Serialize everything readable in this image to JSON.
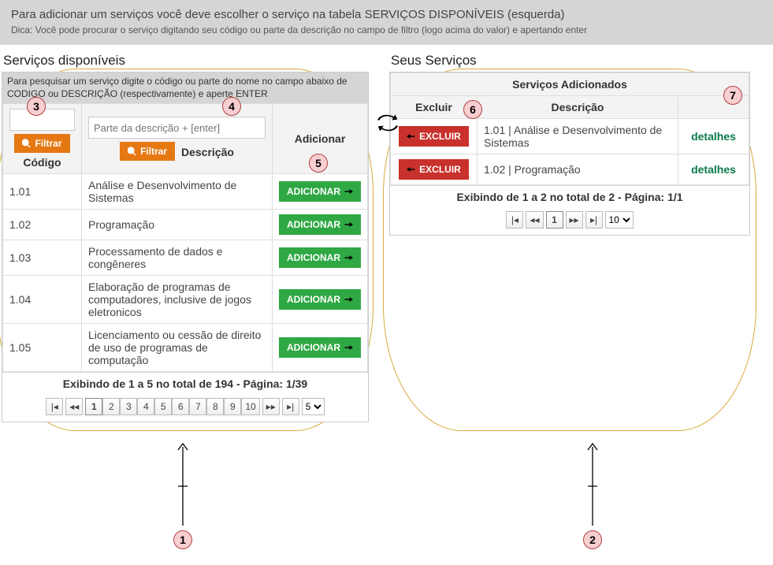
{
  "banner": {
    "title": "Para adicionar um serviços você deve escolher o serviço na tabela SERVIÇOS DISPONÍVEIS (esquerda)",
    "hint": "Dica: Você pode procurar o serviço digitando seu código ou parte da descrição no campo de filtro (logo acima do valor) e apertando enter"
  },
  "left": {
    "title": "Serviços disponíveis",
    "searchHint": "Para pesquisar um serviço digite o código ou parte do nome no campo abaixo de CODIGO ou DESCRIÇÃO (respectivamente) e aperte ENTER",
    "headers": {
      "codigo": "Código",
      "descricao": "Descrição",
      "adicionar": "Adicionar"
    },
    "filters": {
      "codigo_placeholder": "",
      "descricao_placeholder": "Parte da descrição + [enter]",
      "botao_label": "Filtrar"
    },
    "btn_add_label": "ADICIONAR",
    "rows": [
      {
        "codigo": "1.01",
        "descricao": "Análise e Desenvolvimento de Sistemas"
      },
      {
        "codigo": "1.02",
        "descricao": "Programação"
      },
      {
        "codigo": "1.03",
        "descricao": "Processamento de dados e congêneres"
      },
      {
        "codigo": "1.04",
        "descricao": "Elaboração de programas de computadores, inclusive de jogos eletronicos"
      },
      {
        "codigo": "1.05",
        "descricao": "Licenciamento ou cessão de direito de uso de programas de computação"
      }
    ],
    "footer": "Exibindo de 1 a 5 no total de 194 - Página: 1/39",
    "pager": {
      "pages": [
        "1",
        "2",
        "3",
        "4",
        "5",
        "6",
        "7",
        "8",
        "9",
        "10"
      ],
      "active": "1",
      "page_size": "5"
    }
  },
  "right": {
    "title": "Seus Serviços",
    "added_title": "Serviços Adicionados",
    "headers": {
      "excluir": "Excluir",
      "descricao": "Descrição",
      "detalhes": ""
    },
    "btn_del_label": "EXCLUIR",
    "details_label": "detalhes",
    "rows": [
      {
        "descricao": "1.01 | Análise e Desenvolvimento de Sistemas"
      },
      {
        "descricao": "1.02 | Programação"
      }
    ],
    "footer": "Exibindo de 1 a 2 no total de 2 - Página: 1/1",
    "pager": {
      "pages": [
        "1"
      ],
      "active": "1",
      "page_size": "10"
    }
  },
  "callouts": {
    "c1": "1",
    "c2": "2",
    "c3": "3",
    "c4": "4",
    "c5": "5",
    "c6": "6",
    "c7": "7"
  },
  "pager_icons": {
    "first": "⏮",
    "prev": "◀◀",
    "next": "▶▶",
    "last": "⏭",
    "fwd": "▸▸",
    "back": "◂◂",
    "ffirst": "|◂",
    "llast": "▸|"
  }
}
